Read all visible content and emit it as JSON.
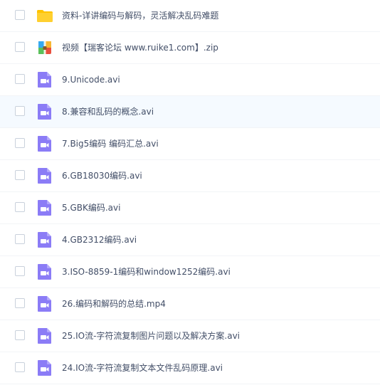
{
  "files": [
    {
      "name": "资料-详讲编码与解码，灵活解决乱码难题",
      "icon": "folder-icon",
      "type": "folder"
    },
    {
      "name": "视频【瑞客论坛 www.ruike1.com】.zip",
      "icon": "archive-icon",
      "type": "zip"
    },
    {
      "name": "9.Unicode.avi",
      "icon": "video-icon",
      "type": "video"
    },
    {
      "name": "8.兼容和乱码的概念.avi",
      "icon": "video-icon",
      "type": "video",
      "hovered": true
    },
    {
      "name": "7.Big5编码 编码汇总.avi",
      "icon": "video-icon",
      "type": "video"
    },
    {
      "name": "6.GB18030编码.avi",
      "icon": "video-icon",
      "type": "video"
    },
    {
      "name": "5.GBK编码.avi",
      "icon": "video-icon",
      "type": "video"
    },
    {
      "name": "4.GB2312编码.avi",
      "icon": "video-icon",
      "type": "video"
    },
    {
      "name": "3.ISO-8859-1编码和window1252编码.avi",
      "icon": "video-icon",
      "type": "video"
    },
    {
      "name": "26.编码和解码的总结.mp4",
      "icon": "video-icon",
      "type": "video"
    },
    {
      "name": "25.IO流-字符流复制图片问题以及解决方案.avi",
      "icon": "video-icon",
      "type": "video"
    },
    {
      "name": "24.IO流-字符流复制文本文件乱码原理.avi",
      "icon": "video-icon",
      "type": "video"
    }
  ],
  "colors": {
    "folder": "#ffc400",
    "video": "#8b7cf6",
    "hover_row": "#f5faff",
    "text": "#424e67"
  }
}
